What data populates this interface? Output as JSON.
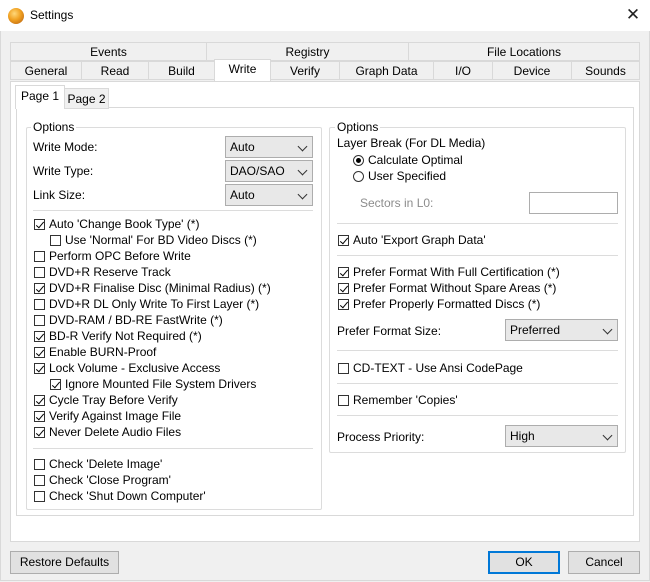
{
  "window": {
    "title": "Settings",
    "close_glyph": "✕",
    "icon": "app-icon"
  },
  "tabs": {
    "row1": [
      "Events",
      "Registry",
      "File Locations"
    ],
    "row2": [
      "General",
      "Read",
      "Build",
      "Write",
      "Verify",
      "Graph Data",
      "I/O",
      "Device",
      "Sounds"
    ],
    "active": "Write"
  },
  "subtabs": {
    "items": [
      "Page 1",
      "Page 2"
    ],
    "active": "Page 1"
  },
  "left": {
    "group_title": "Options",
    "write_mode": {
      "label": "Write Mode:",
      "value": "Auto"
    },
    "write_type": {
      "label": "Write Type:",
      "value": "DAO/SAO"
    },
    "link_size": {
      "label": "Link Size:",
      "value": "Auto"
    },
    "checks": [
      {
        "label": "Auto 'Change Book Type' (*)",
        "checked": true
      },
      {
        "label": "Use 'Normal' For BD Video Discs (*)",
        "checked": false
      },
      {
        "label": "Perform OPC Before Write",
        "checked": false
      },
      {
        "label": "DVD+R Reserve Track",
        "checked": false
      },
      {
        "label": "DVD+R Finalise Disc (Minimal Radius) (*)",
        "checked": true
      },
      {
        "label": "DVD+R DL Only Write To First Layer (*)",
        "checked": false
      },
      {
        "label": "DVD-RAM / BD-RE FastWrite (*)",
        "checked": false
      },
      {
        "label": "BD-R Verify Not Required (*)",
        "checked": true
      },
      {
        "label": "Enable BURN-Proof",
        "checked": true
      },
      {
        "label": "Lock Volume - Exclusive Access",
        "checked": true
      },
      {
        "label": "Ignore Mounted File System Drivers",
        "checked": true
      },
      {
        "label": "Cycle Tray Before Verify",
        "checked": true
      },
      {
        "label": "Verify Against Image File",
        "checked": true
      },
      {
        "label": "Never Delete Audio Files",
        "checked": true
      }
    ],
    "checks2": [
      {
        "label": "Check 'Delete Image'",
        "checked": false
      },
      {
        "label": "Check 'Close Program'",
        "checked": false
      },
      {
        "label": "Check 'Shut Down Computer'",
        "checked": false
      }
    ]
  },
  "right": {
    "group_title": "Options",
    "layer_break_label": "Layer Break (For DL Media)",
    "radio_optimal": {
      "label": "Calculate Optimal",
      "selected": true
    },
    "radio_user": {
      "label": "User Specified",
      "selected": false
    },
    "sectors_label": "Sectors in L0:",
    "sectors_value": "",
    "export_graph": {
      "label": "Auto 'Export Graph Data'",
      "checked": true
    },
    "prefer_checks": [
      {
        "label": "Prefer Format With Full Certification (*)",
        "checked": true
      },
      {
        "label": "Prefer Format Without Spare Areas (*)",
        "checked": true
      },
      {
        "label": "Prefer Properly Formatted Discs (*)",
        "checked": true
      }
    ],
    "prefer_size": {
      "label": "Prefer Format Size:",
      "value": "Preferred"
    },
    "cdtext": {
      "label": "CD-TEXT - Use Ansi CodePage",
      "checked": false
    },
    "remember": {
      "label": "Remember 'Copies'",
      "checked": false
    },
    "priority": {
      "label": "Process Priority:",
      "value": "High"
    }
  },
  "buttons": {
    "restore": "Restore Defaults",
    "ok": "OK",
    "cancel": "Cancel"
  }
}
